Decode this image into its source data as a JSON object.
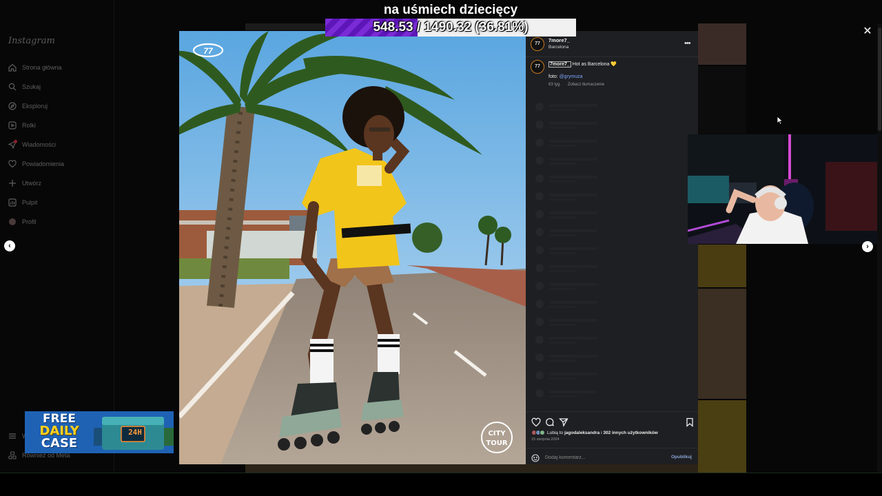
{
  "overlay": {
    "title": "na uśmiech dziecięcy",
    "progress_current": "548.53",
    "progress_total": "1490.32",
    "progress_percent": "36.81%",
    "progress_fraction": 0.3681,
    "progress_text": "548.53 / 1490.32 (36.81%)",
    "progress_color": "#7a2bd6"
  },
  "sidebar": {
    "logo": "Instagram",
    "items": [
      {
        "label": "Strona główna",
        "icon": "home-icon"
      },
      {
        "label": "Szukaj",
        "icon": "search-icon"
      },
      {
        "label": "Eksploruj",
        "icon": "compass-icon"
      },
      {
        "label": "Rolki",
        "icon": "reels-icon"
      },
      {
        "label": "Wiadomości",
        "icon": "messenger-icon"
      },
      {
        "label": "Powiadomienia",
        "icon": "heart-icon"
      },
      {
        "label": "Utwórz",
        "icon": "plus-icon"
      },
      {
        "label": "Pulpit",
        "icon": "dashboard-icon"
      },
      {
        "label": "Profil",
        "icon": "profile-icon"
      }
    ],
    "more_label": "W",
    "meta_label": "Również od Meta"
  },
  "post": {
    "account": "7more7_",
    "location": "Barcelona",
    "avatar_text": "77",
    "caption_user": "7more7_",
    "caption_text": "Hot as Barcelona 💛",
    "foto_label": "foto:",
    "foto_mention": "@grymuza",
    "age": "63 tyg.",
    "translate": "Zobacz tłumaczenie",
    "likes_prefix": "Lubią to",
    "likes_user": "jagodaleksandra",
    "likes_middle": "i",
    "likes_count": "302 innych użytkowników",
    "date": "15 sierpnia 2024",
    "comment_placeholder": "Dodaj komentarz...",
    "publish_label": "Opublikuj"
  },
  "photo": {
    "brand_logo": "77",
    "badge_line1": "CITY",
    "badge_line2": "TOUR"
  },
  "ad": {
    "line1": "FREE",
    "line2": "DAILY",
    "line3": "CASE",
    "badge": "24H"
  },
  "controls": {
    "close": "✕",
    "prev": "‹",
    "next": "›"
  }
}
